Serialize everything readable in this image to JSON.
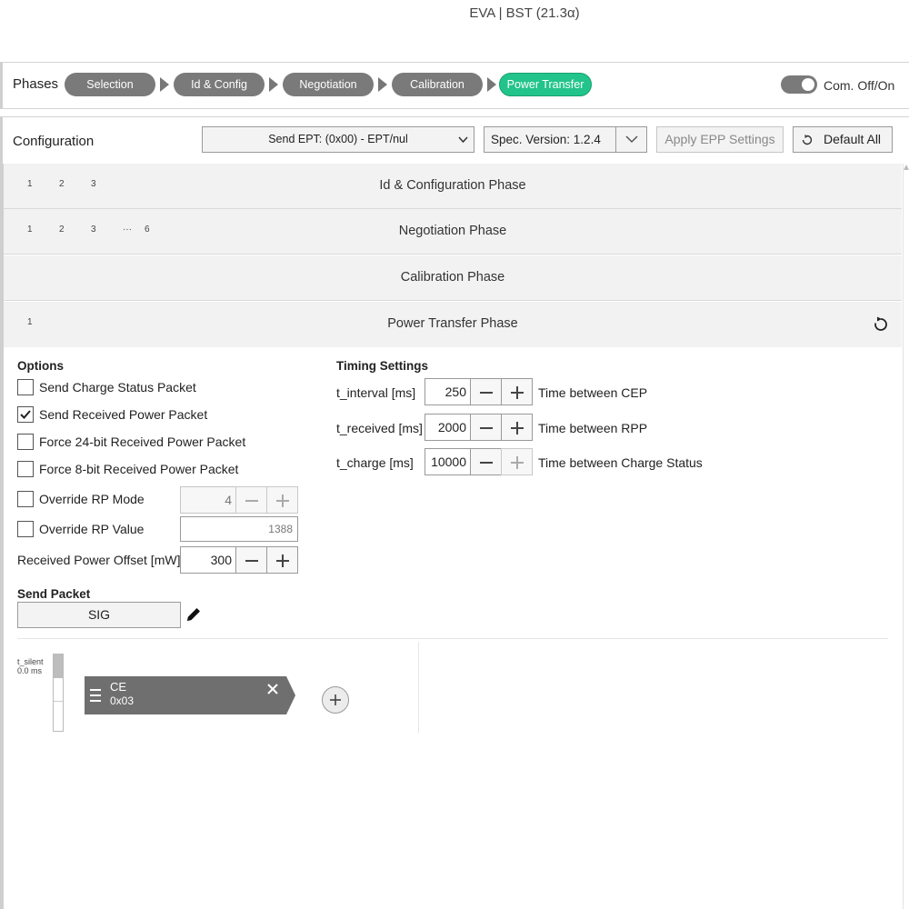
{
  "app": {
    "title": "EVA | BST (21.3α)"
  },
  "phases": {
    "label": "Phases",
    "items": [
      {
        "label": "Selection",
        "active": false
      },
      {
        "label": "Id & Config",
        "active": false
      },
      {
        "label": "Negotiation",
        "active": false
      },
      {
        "label": "Calibration",
        "active": false
      },
      {
        "label": "Power Transfer",
        "active": true
      }
    ],
    "toggle_label": "Com. Off/On"
  },
  "config": {
    "label": "Configuration",
    "ept_select_value": "Send EPT:  (0x00) - EPT/nul",
    "spec_version_value": "Spec. Version: 1.2.4",
    "apply_label": "Apply EPP Settings",
    "default_label": "Default All"
  },
  "accordion": [
    {
      "title": "Id & Configuration Phase",
      "steps": [
        "1",
        "2",
        "3"
      ]
    },
    {
      "title": "Negotiation Phase",
      "steps": [
        "1",
        "2",
        "3",
        "···",
        "6"
      ]
    },
    {
      "title": "Calibration Phase",
      "steps": []
    },
    {
      "title": "Power Transfer Phase",
      "steps": [
        "1"
      ]
    }
  ],
  "options": {
    "heading": "Options",
    "checkboxes": [
      {
        "label": "Send Charge Status Packet",
        "checked": false
      },
      {
        "label": "Send Received Power Packet",
        "checked": true
      },
      {
        "label": "Force 24-bit Received Power Packet",
        "checked": false
      },
      {
        "label": "Force 8-bit Received Power Packet",
        "checked": false
      }
    ],
    "override_rp_mode": {
      "label": "Override RP Mode",
      "value": "4",
      "checked": false
    },
    "override_rp_value": {
      "label": "Override RP Value",
      "value": "1388",
      "checked": false
    },
    "rp_offset": {
      "label": "Received Power Offset [mW]",
      "value": "300"
    }
  },
  "timing": {
    "heading": "Timing Settings",
    "rows": [
      {
        "label": "t_interval [ms]",
        "value": "250",
        "desc": "Time between CEP"
      },
      {
        "label": "t_received [ms]",
        "value": "2000",
        "desc": "Time between RPP"
      },
      {
        "label": "t_charge [ms]",
        "value": "10000",
        "desc": "Time between Charge Status"
      }
    ]
  },
  "send_packet": {
    "heading": "Send Packet",
    "button_label": "SIG"
  },
  "timeline": {
    "silent_label": "t_silent",
    "silent_value": "0.0 ms",
    "block": {
      "name": "CE",
      "code": "0x03"
    }
  },
  "colors": {
    "active_phase": "#22c48b",
    "pill": "#7a7a7a",
    "block": "#6f6f6f"
  },
  "icons": [
    "reset-icon",
    "pencil-icon",
    "close-icon",
    "drag-handle-icon",
    "plus-icon",
    "minus-icon",
    "chevron-down-icon",
    "checkmark-icon"
  ]
}
